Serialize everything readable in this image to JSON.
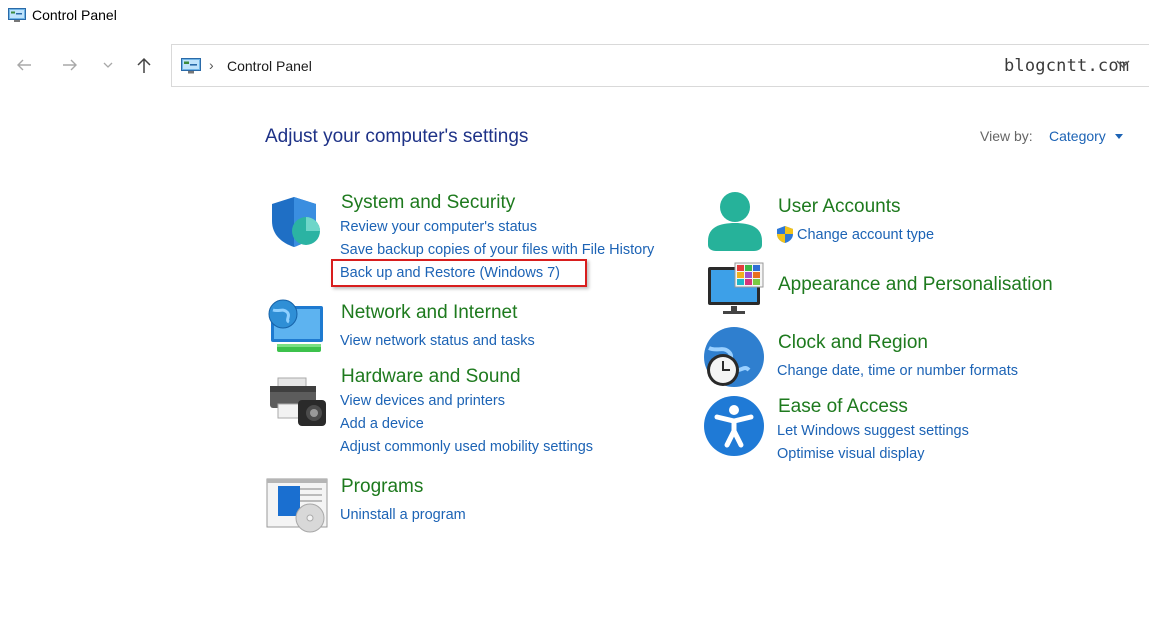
{
  "window": {
    "title": "Control Panel"
  },
  "address": {
    "path_label": "Control Panel",
    "watermark": "blogcntt.com"
  },
  "nav": {
    "back_icon": "arrow-left-icon",
    "forward_icon": "arrow-right-icon",
    "recent_icon": "chevron-down-icon",
    "up_icon": "arrow-up-icon"
  },
  "header": {
    "title": "Adjust your computer's settings",
    "view_by_label": "View by:",
    "view_by_value": "Category"
  },
  "categories": {
    "system_security": {
      "title": "System and Security",
      "links": [
        "Review your computer's status",
        "Save backup copies of your files with File History",
        "Back up and Restore (Windows 7)"
      ]
    },
    "network": {
      "title": "Network and Internet",
      "links": [
        "View network status and tasks"
      ]
    },
    "hardware": {
      "title": "Hardware and Sound",
      "links": [
        "View devices and printers",
        "Add a device",
        "Adjust commonly used mobility settings"
      ]
    },
    "programs": {
      "title": "Programs",
      "links": [
        "Uninstall a program"
      ]
    },
    "user_accounts": {
      "title": "User Accounts",
      "links": [
        "Change account type"
      ]
    },
    "appearance": {
      "title": "Appearance and Personalisation",
      "links": []
    },
    "clock": {
      "title": "Clock and Region",
      "links": [
        "Change date, time or number formats"
      ]
    },
    "ease": {
      "title": "Ease of Access",
      "links": [
        "Let Windows suggest settings",
        "Optimise visual display"
      ]
    }
  },
  "colors": {
    "category_title": "#1e7a1e",
    "link": "#1c63b5",
    "page_title": "#1e3287",
    "highlight": "#d81e1e"
  }
}
